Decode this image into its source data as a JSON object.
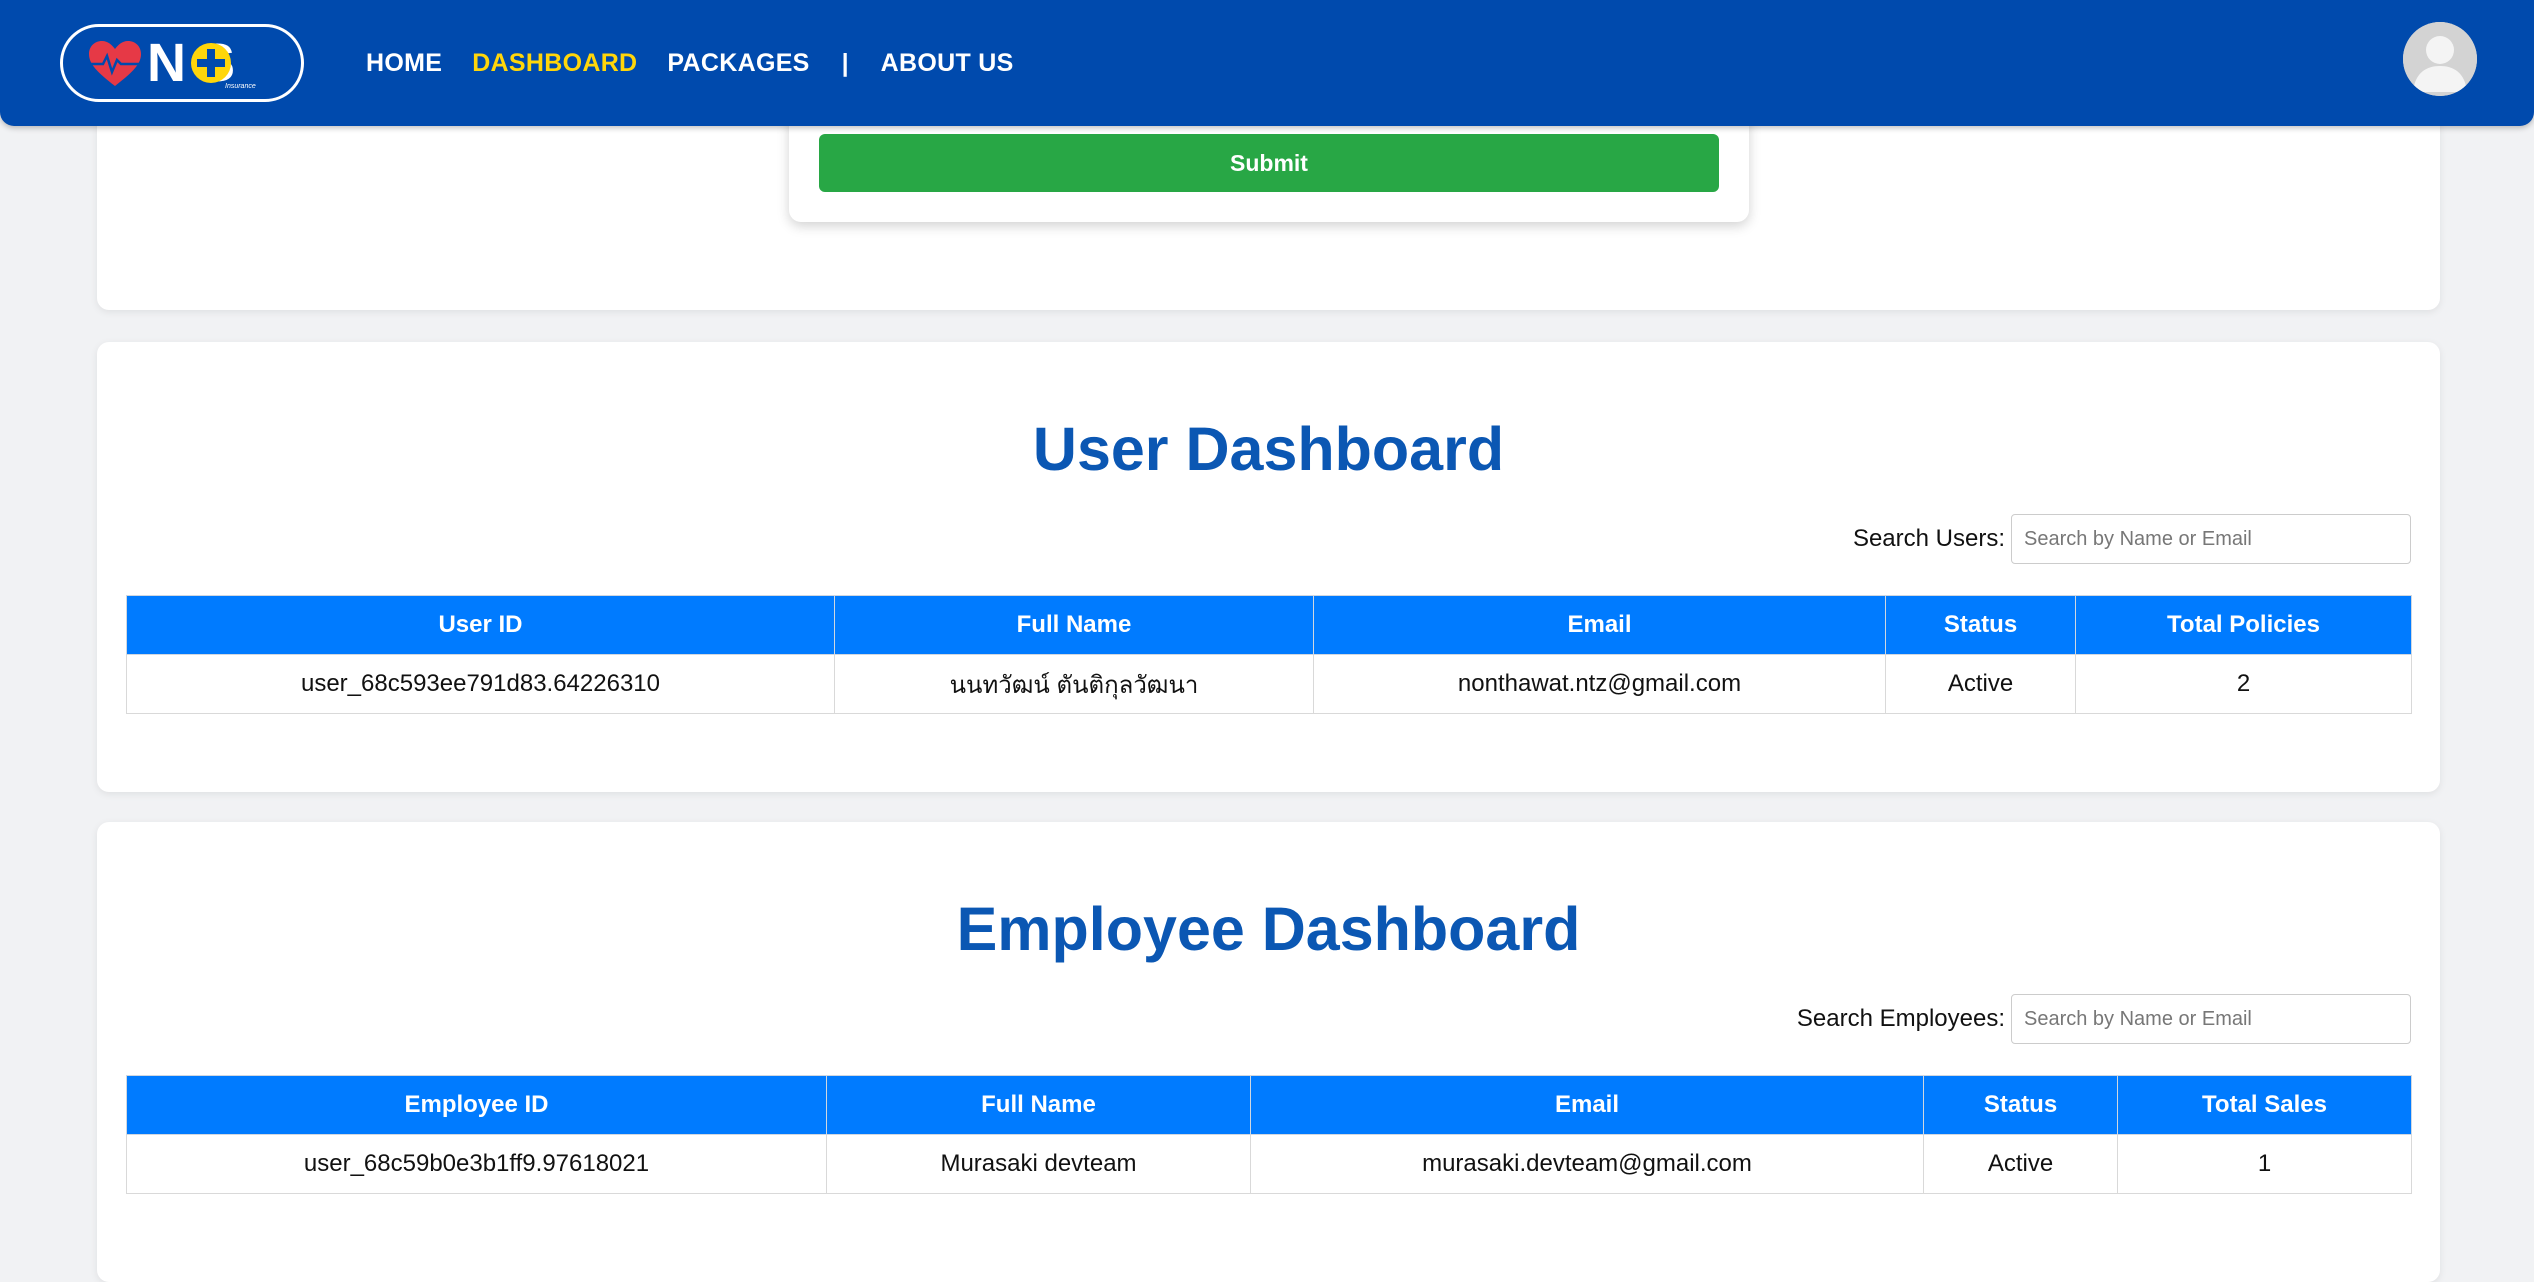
{
  "brand": {
    "logo_text": "N S",
    "logo_sub": "Insurance",
    "colors": {
      "primary": "#004aad",
      "accent": "#ffd60a",
      "table_header": "#007bff",
      "submit": "#28a745",
      "title": "#0b57b3"
    }
  },
  "nav": {
    "items": [
      {
        "label": "HOME",
        "active": false
      },
      {
        "label": "DASHBOARD",
        "active": true
      },
      {
        "label": "PACKAGES",
        "active": false
      },
      {
        "label": "ABOUT US",
        "active": false
      }
    ],
    "separator": "|"
  },
  "form": {
    "submit_label": "Submit"
  },
  "user_dashboard": {
    "title": "User Dashboard",
    "search_label": "Search Users:",
    "search_placeholder": "Search by Name or Email",
    "columns": [
      "User ID",
      "Full Name",
      "Email",
      "Status",
      "Total Policies"
    ],
    "rows": [
      [
        "user_68c593ee791d83.64226310",
        "นนทวัฒน์ ตันติกุลวัฒนา",
        "nonthawat.ntz@gmail.com",
        "Active",
        "2"
      ]
    ]
  },
  "employee_dashboard": {
    "title": "Employee Dashboard",
    "search_label": "Search Employees:",
    "search_placeholder": "Search by Name or Email",
    "columns": [
      "Employee ID",
      "Full Name",
      "Email",
      "Status",
      "Total Sales"
    ],
    "rows": [
      [
        "user_68c59b0e3b1ff9.97618021",
        "Murasaki devteam",
        "murasaki.devteam@gmail.com",
        "Active",
        "1"
      ]
    ]
  }
}
